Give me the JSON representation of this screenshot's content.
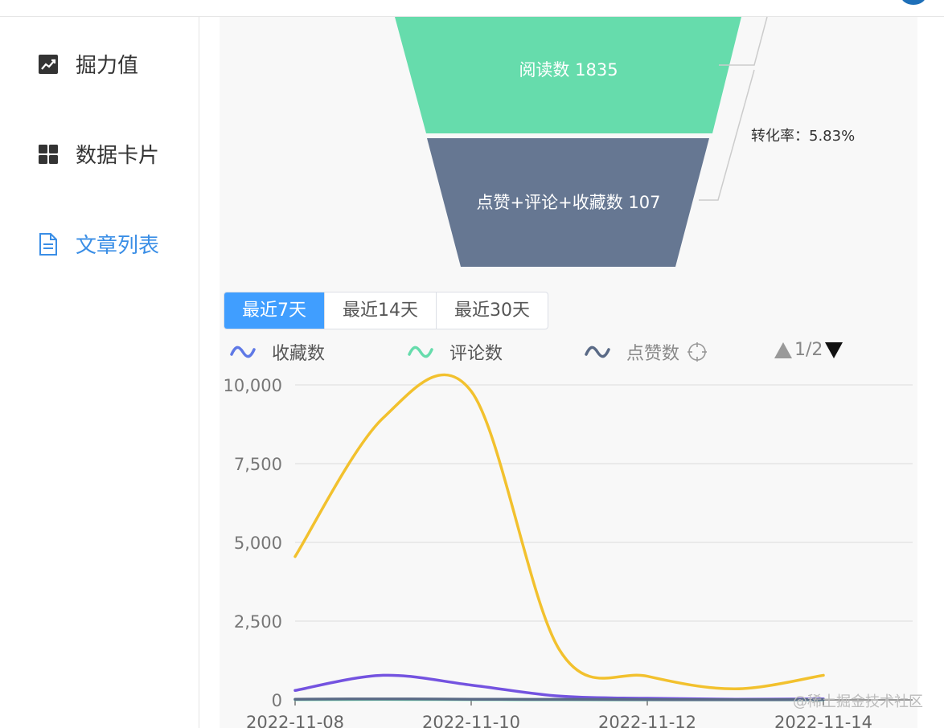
{
  "sidebar": {
    "items": [
      {
        "label": "掘力值",
        "icon": "trend-chart-icon"
      },
      {
        "label": "数据卡片",
        "icon": "grid-icon"
      },
      {
        "label": "文章列表",
        "icon": "document-icon",
        "active": true
      }
    ]
  },
  "funnel": {
    "stages": [
      {
        "label": "阅读数 1835",
        "color": "#66dcac"
      },
      {
        "label": "点赞+评论+收藏数 107",
        "color": "#667792"
      }
    ],
    "conversion_label": "转化率：5.83%"
  },
  "range_tabs": [
    {
      "label": "最近7天",
      "active": true
    },
    {
      "label": "最近14天",
      "active": false
    },
    {
      "label": "最近30天",
      "active": false
    }
  ],
  "legend": {
    "items": [
      {
        "label": "收藏数",
        "color": "#5f79e6"
      },
      {
        "label": "评论数",
        "color": "#66dcac"
      },
      {
        "label": "点赞数",
        "color": "#667792",
        "faded": true
      }
    ],
    "page_indicator": "1/2"
  },
  "chart_data": {
    "type": "line",
    "x": [
      "2022-11-08",
      "2022-11-09",
      "2022-11-10",
      "2022-11-11",
      "2022-11-12",
      "2022-11-13",
      "2022-11-14"
    ],
    "xticks": [
      "2022-11-08",
      "2022-11-10",
      "2022-11-12",
      "2022-11-14"
    ],
    "yticks": [
      "0",
      "2,500",
      "5,000",
      "7,500",
      "10,000"
    ],
    "ylim": [
      0,
      10000
    ],
    "grid": true,
    "smooth": true,
    "series": [
      {
        "color": "#f2c12e",
        "values": [
          4550,
          8950,
          9800,
          1600,
          750,
          350,
          780
        ]
      },
      {
        "name": "收藏数",
        "color": "#7453e0",
        "values": [
          300,
          780,
          470,
          120,
          50,
          20,
          30
        ]
      },
      {
        "name": "评论数",
        "color": "#66dcac",
        "values": [
          10,
          15,
          10,
          5,
          3,
          2,
          3
        ]
      },
      {
        "name": "点赞数",
        "color": "#5a6a86",
        "values": [
          20,
          30,
          20,
          15,
          10,
          5,
          10
        ]
      }
    ]
  },
  "watermark": "@稀土掘金技术社区"
}
